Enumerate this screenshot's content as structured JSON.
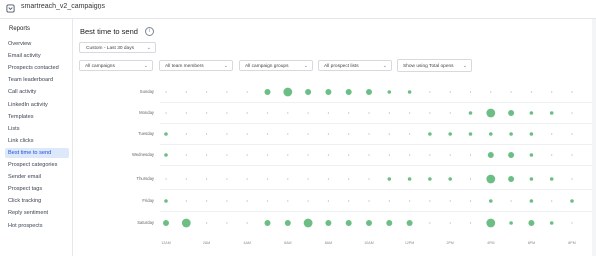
{
  "header": {
    "title": "smartreach_v2_campaigns"
  },
  "sidebar": {
    "section_title": "Reports",
    "items": [
      {
        "label": "Overview",
        "active": false
      },
      {
        "label": "Email activity",
        "active": false
      },
      {
        "label": "Prospects contacted",
        "active": false
      },
      {
        "label": "Team leaderboard",
        "active": false
      },
      {
        "label": "Call activity",
        "active": false
      },
      {
        "label": "LinkedIn activity",
        "active": false
      },
      {
        "label": "Templates",
        "active": false
      },
      {
        "label": "Lists",
        "active": false
      },
      {
        "label": "Link clicks",
        "active": false
      },
      {
        "label": "Best time to send",
        "active": true
      },
      {
        "label": "Prospect categories",
        "active": false
      },
      {
        "label": "Sender email",
        "active": false
      },
      {
        "label": "Prospect tags",
        "active": false
      },
      {
        "label": "Click tracking",
        "active": false
      },
      {
        "label": "Reply sentiment",
        "active": false
      },
      {
        "label": "Hot prospects",
        "active": false
      }
    ]
  },
  "main": {
    "title": "Best time to send",
    "date_range": "Custom - Last 30 days",
    "filters": [
      {
        "label": "All campaigns"
      },
      {
        "label": "All team members"
      },
      {
        "label": "All campaign groups"
      },
      {
        "label": "All prospect lists"
      },
      {
        "label": "Show using Total opens"
      }
    ]
  },
  "chart_data": {
    "type": "scatter",
    "days": [
      "Sunday",
      "Monday",
      "Tuesday",
      "Wednesday",
      "Thursday",
      "Friday",
      "Saturday"
    ],
    "hours": [
      "12AM",
      "",
      "2AM",
      "",
      "4AM",
      "",
      "6AM",
      "",
      "8AM",
      "",
      "10AM",
      "",
      "12PM",
      "",
      "2PM",
      "",
      "4PM",
      "",
      "6PM",
      "",
      "8PM",
      "",
      "10PM",
      ""
    ],
    "hour_labels_shown": [
      "12AM",
      "2AM",
      "4AM",
      "6AM",
      "8AM",
      "10AM",
      "12PM",
      "2PM",
      "4PM",
      "6PM",
      "8PM",
      "10PM"
    ],
    "values": [
      [
        0,
        0,
        0,
        0,
        0,
        2,
        3,
        2,
        2,
        2,
        2,
        1,
        1,
        0,
        0,
        0,
        0,
        0,
        0,
        0,
        0,
        0,
        0,
        0
      ],
      [
        0,
        0,
        0,
        0,
        0,
        0,
        0,
        0,
        0,
        0,
        0,
        0,
        0,
        0,
        0,
        1,
        3,
        2,
        1,
        1,
        0,
        0,
        0,
        0
      ],
      [
        1,
        0,
        0,
        0,
        0,
        0,
        0,
        0,
        0,
        0,
        0,
        0,
        0,
        1,
        1,
        1,
        1,
        1,
        1,
        0,
        0,
        0,
        0,
        0
      ],
      [
        1,
        0,
        0,
        0,
        0,
        0,
        0,
        0,
        0,
        0,
        0,
        0,
        0,
        0,
        0,
        0,
        2,
        2,
        1,
        0,
        0,
        0,
        0,
        0
      ],
      [
        0,
        0,
        0,
        0,
        0,
        0,
        0,
        0,
        0,
        0,
        0,
        1,
        1,
        1,
        1,
        0,
        3,
        2,
        1,
        1,
        0,
        1,
        0,
        0
      ],
      [
        1,
        0,
        0,
        0,
        0,
        0,
        0,
        0,
        0,
        0,
        0,
        0,
        0,
        0,
        0,
        0,
        1,
        0,
        1,
        0,
        1,
        0,
        1,
        0
      ],
      [
        2,
        3,
        0,
        0,
        0,
        2,
        2,
        3,
        2,
        2,
        2,
        2,
        2,
        0,
        0,
        0,
        3,
        1,
        2,
        1,
        0,
        0,
        0,
        0
      ]
    ],
    "color": "#6cbf84",
    "grid": false,
    "legend": "none"
  }
}
